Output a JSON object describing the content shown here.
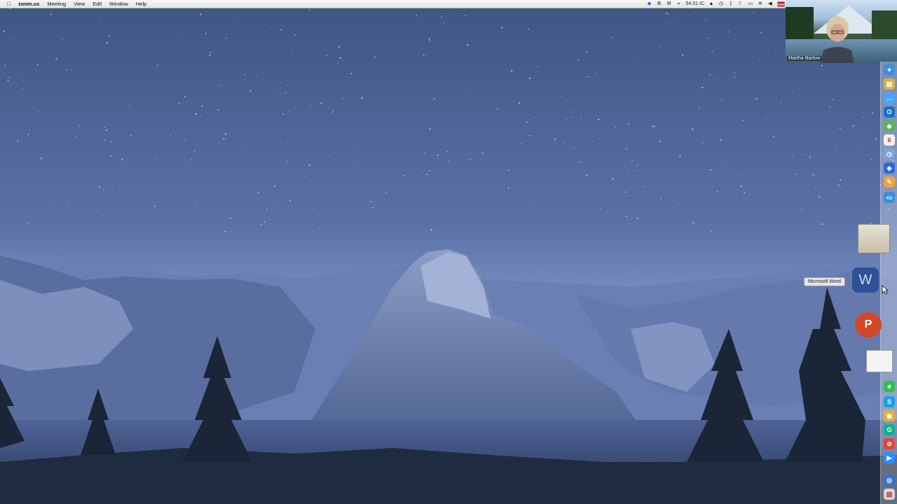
{
  "menubar": {
    "apple_icon": "apple-logo",
    "app_name": "zoom.us",
    "menus": [
      "Meeting",
      "View",
      "Edit",
      "Window",
      "Help"
    ],
    "clock": "54:31 IC"
  },
  "video": {
    "participant_name": "Martha Barlow"
  },
  "dock": {
    "tooltip": "Microsoft Word",
    "word_letter": "W",
    "powerpoint_letter": "P",
    "items": [
      {
        "name": "safari-icon",
        "color": "#3b8fe0",
        "glyph": "✦"
      },
      {
        "name": "notes-icon",
        "color": "#d8b04a",
        "glyph": "▤"
      },
      {
        "name": "messages-icon",
        "color": "#4aa3ff",
        "glyph": "…"
      },
      {
        "name": "outlook-icon",
        "color": "#1b6fc9",
        "glyph": "O"
      },
      {
        "name": "maps-icon",
        "color": "#5bb35b",
        "glyph": "◈"
      },
      {
        "name": "calendar-icon",
        "color": "#f2f2f2",
        "glyph": "6"
      },
      {
        "name": "clock-icon",
        "color": "#7ea4d6",
        "glyph": "◷"
      },
      {
        "name": "shortcuts-icon",
        "color": "#2f66e0",
        "glyph": "◆"
      },
      {
        "name": "pages-icon",
        "color": "#f0a33a",
        "glyph": "✎"
      },
      {
        "name": "keynote-icon",
        "color": "#3a8fd8",
        "glyph": "▭"
      },
      {
        "name": "facetime-icon",
        "color": "#2fbf4a",
        "glyph": "■"
      },
      {
        "name": "skype-icon",
        "color": "#1ca0e6",
        "glyph": "S"
      },
      {
        "name": "chrome-icon",
        "color": "#e0b23a",
        "glyph": "◉"
      },
      {
        "name": "grammarly-icon",
        "color": "#15b08d",
        "glyph": "G"
      },
      {
        "name": "blocker-icon",
        "color": "#e0453a",
        "glyph": "⊘"
      },
      {
        "name": "zoom-icon",
        "color": "#2d8cff",
        "glyph": "▶"
      },
      {
        "name": "browser-icon",
        "color": "#3a73c9",
        "glyph": "◎"
      },
      {
        "name": "preview-icon",
        "color": "#cfd6de",
        "glyph": "▨"
      }
    ]
  }
}
